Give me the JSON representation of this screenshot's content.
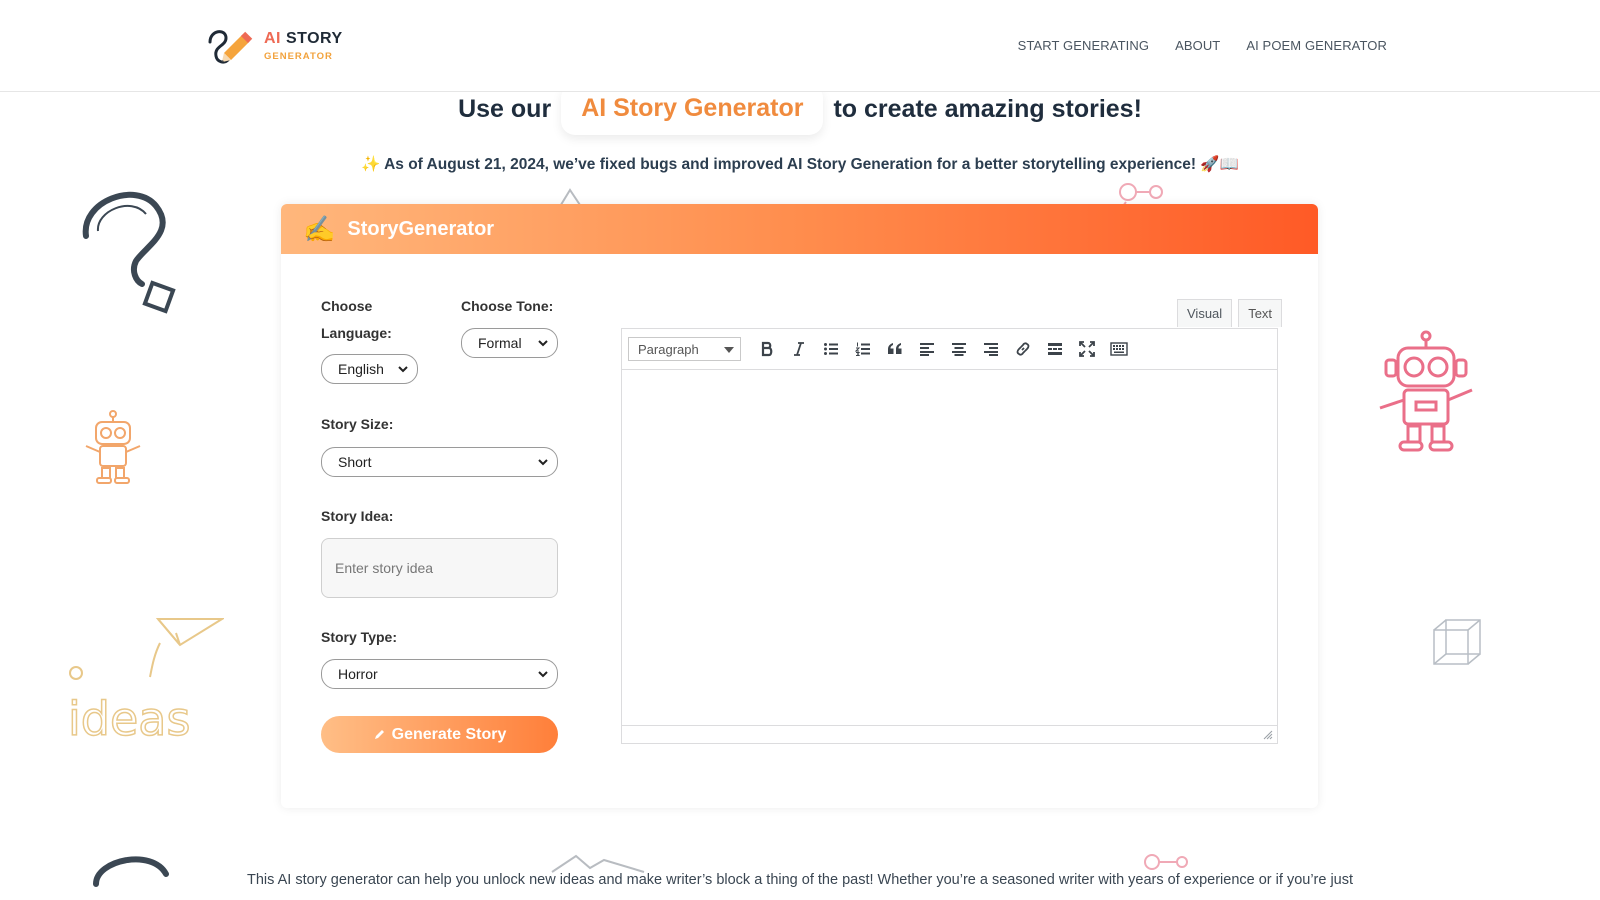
{
  "header": {
    "logo": {
      "ai": "AI",
      "story": "STORY",
      "sub": "GENERATOR"
    },
    "nav": [
      {
        "label": "START GENERATING"
      },
      {
        "label": "ABOUT"
      },
      {
        "label": "AI POEM GENERATOR"
      }
    ]
  },
  "hero": {
    "pre": "Use our",
    "highlight": "AI Story Generator",
    "post": "to create amazing stories!"
  },
  "notice": {
    "sparkle": "✨",
    "text": "As of August 21, 2024, we’ve fixed bugs and improved AI Story Generation for a better storytelling experience!",
    "emojis": "🚀📖"
  },
  "card": {
    "icon": "✍️",
    "title": "StoryGenerator",
    "language": {
      "label_line1": "Choose",
      "label_line2": "Language:",
      "value": "English"
    },
    "tone": {
      "label": "Choose Tone:",
      "value": "Formal"
    },
    "size": {
      "label": "Story Size:",
      "value": "Short"
    },
    "idea": {
      "label": "Story Idea:",
      "placeholder": "Enter story idea"
    },
    "type": {
      "label": "Story Type:",
      "value": "Horror"
    },
    "generate_label": "Generate Story",
    "editor": {
      "tabs": [
        "Visual",
        "Text"
      ],
      "format_value": "Paragraph",
      "toolbar_icons": [
        "bold-icon",
        "italic-icon",
        "bullet-list-icon",
        "numbered-list-icon",
        "blockquote-icon",
        "align-left-icon",
        "align-center-icon",
        "align-right-icon",
        "link-icon",
        "read-more-icon",
        "fullscreen-icon",
        "toolbar-toggle-icon"
      ]
    }
  },
  "intro": "This AI story generator can help you unlock new ideas and make writer’s block a thing of the past! Whether you’re a seasoned writer with years of experience or if you’re just",
  "colors": {
    "accent": "#ff7f3a",
    "accent_light": "#ffb77c",
    "highlight_text": "#f08b3e"
  }
}
